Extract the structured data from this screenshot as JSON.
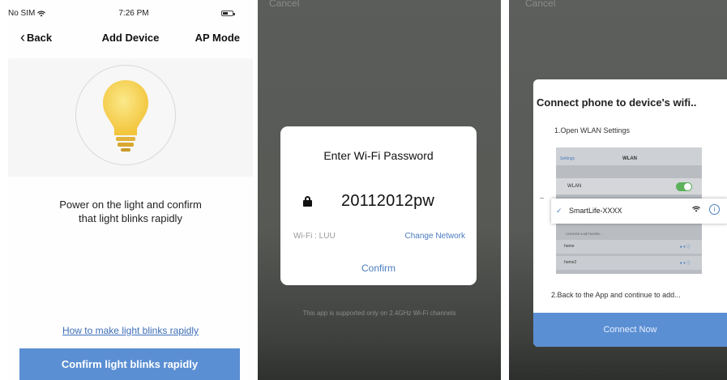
{
  "panel1": {
    "status": {
      "carrier": "No SIM",
      "time": "7:26 PM"
    },
    "nav": {
      "back": "Back",
      "title": "Add Device",
      "ap_mode": "AP Mode"
    },
    "instruction_line1": "Power on the light and confirm",
    "instruction_line2": "that light blinks  rapidly",
    "howto_link": "How to make light blinks rapidly",
    "confirm_button": "Confirm light blinks rapidly"
  },
  "panel2": {
    "cancel": "Cancel",
    "dialog": {
      "title": "Enter Wi-Fi Password",
      "password": "20112012pw",
      "wifi_label": "Wi-Fi : LUU",
      "change_network": "Change Network",
      "confirm": "Confirm"
    },
    "note": "This app is supported only on 2.4GHz Wi-Fi channels"
  },
  "panel3": {
    "cancel": "Cancel",
    "card": {
      "title": "Connect phone to device's wifi..",
      "step1": "1.Open WLAN Settings",
      "mock": {
        "back": "Settings",
        "title": "WLAN",
        "wlan_label": "WLAN",
        "choose": "CHOOSE A NETWORK...",
        "networks": [
          "home",
          "home2"
        ]
      },
      "highlighted_network": "SmartLife-XXXX",
      "step2": "2.Back to the App and continue to add...",
      "connect_button": "Connect Now"
    }
  },
  "colors": {
    "accent": "#5b8fd3",
    "link": "#4a7bc0",
    "bulb": "#f7d55c"
  }
}
